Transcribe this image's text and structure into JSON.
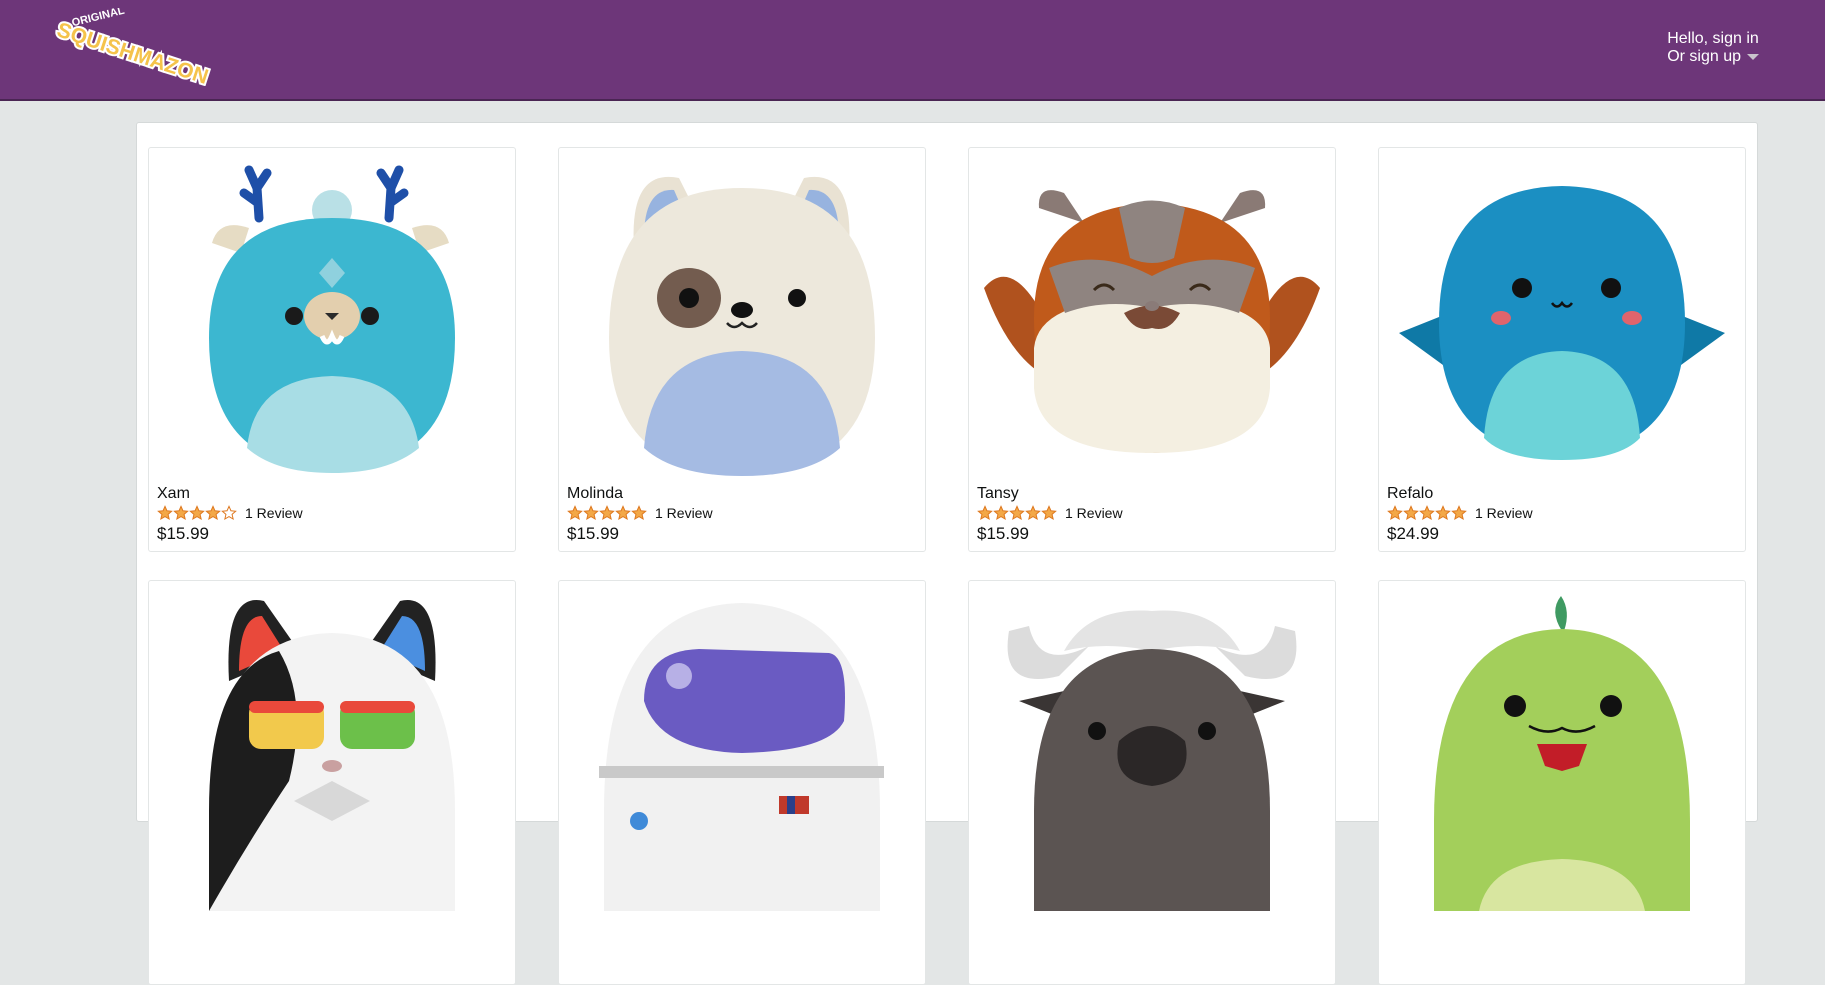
{
  "header": {
    "logo_text": "SQUISHMAZON",
    "logo_badge": "ORIGINAL",
    "account_line1": "Hello, sign in",
    "account_line2": "Or sign up"
  },
  "colors": {
    "header_bg": "#6d3679",
    "star": "#f3a847",
    "page_bg": "#e3e6e6"
  },
  "products": [
    {
      "name": "Xam",
      "rating": 4,
      "reviews": "1 Review",
      "price": "$15.99",
      "icon": "xam-plush-image"
    },
    {
      "name": "Molinda",
      "rating": 5,
      "reviews": "1 Review",
      "price": "$15.99",
      "icon": "molinda-plush-image"
    },
    {
      "name": "Tansy",
      "rating": 5,
      "reviews": "1 Review",
      "price": "$15.99",
      "icon": "tansy-plush-image"
    },
    {
      "name": "Refalo",
      "rating": 5,
      "reviews": "1 Review",
      "price": "$24.99",
      "icon": "refalo-plush-image"
    },
    {
      "icon": "rainbow-cat-plush-image"
    },
    {
      "icon": "astronaut-plush-image"
    },
    {
      "icon": "buffalo-plush-image"
    },
    {
      "icon": "green-dino-plush-image"
    }
  ]
}
